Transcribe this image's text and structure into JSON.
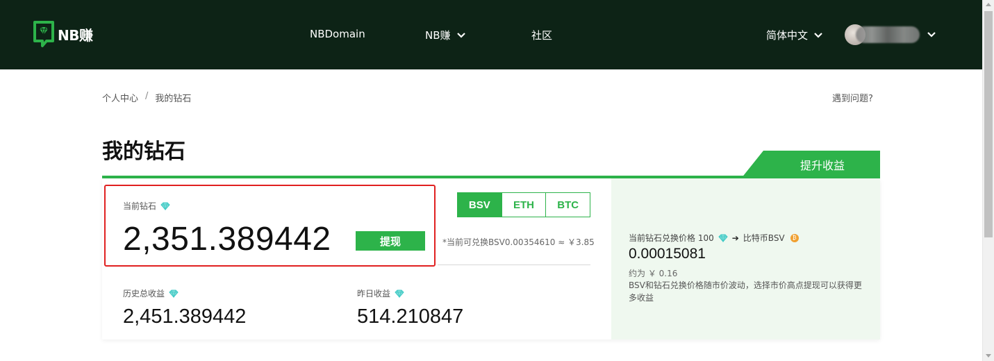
{
  "nav": {
    "brand": "NB赚",
    "links": [
      "NBDomain",
      "NB赚",
      "社区"
    ],
    "language": "简体中文"
  },
  "breadcrumb": {
    "home": "个人中心",
    "separator": "/",
    "current": "我的钻石"
  },
  "help_link": "遇到问题?",
  "page_title": "我的钻石",
  "boost_tab": "提升收益",
  "current_diamonds": {
    "label": "当前钻石",
    "value": "2,351.389442",
    "withdraw_label": "提现"
  },
  "coin_tabs": {
    "items": [
      "BSV",
      "ETH",
      "BTC"
    ],
    "active": "BSV"
  },
  "exchange_note": "*当前可兑换BSV0.00354610 ≈ ￥3.85",
  "history_earnings": {
    "label": "历史总收益",
    "value": "2,451.389442"
  },
  "yesterday_earnings": {
    "label": "昨日收益",
    "value": "514.210847"
  },
  "rate_panel": {
    "label_prefix": "当前钻石兑换价格 100",
    "arrow": "➔",
    "label_suffix": "比特币BSV",
    "coin_symbol": "₿",
    "value": "0.00015081",
    "cny": "约为 ￥ 0.16",
    "description": "BSV和钻石兑换价格随市价波动，选择市价高点提现可以获得更多收益"
  },
  "colors": {
    "nav_bg": "#0d2316",
    "accent": "#2db34a",
    "panel_bg": "#eff8ef",
    "highlight_box": "#e02020",
    "diamond": "#3cc9c4"
  },
  "icons": [
    "nb-logo-icon",
    "chevron-down-icon",
    "diamond-icon",
    "arrow-right-icon",
    "bsv-coin-icon"
  ]
}
